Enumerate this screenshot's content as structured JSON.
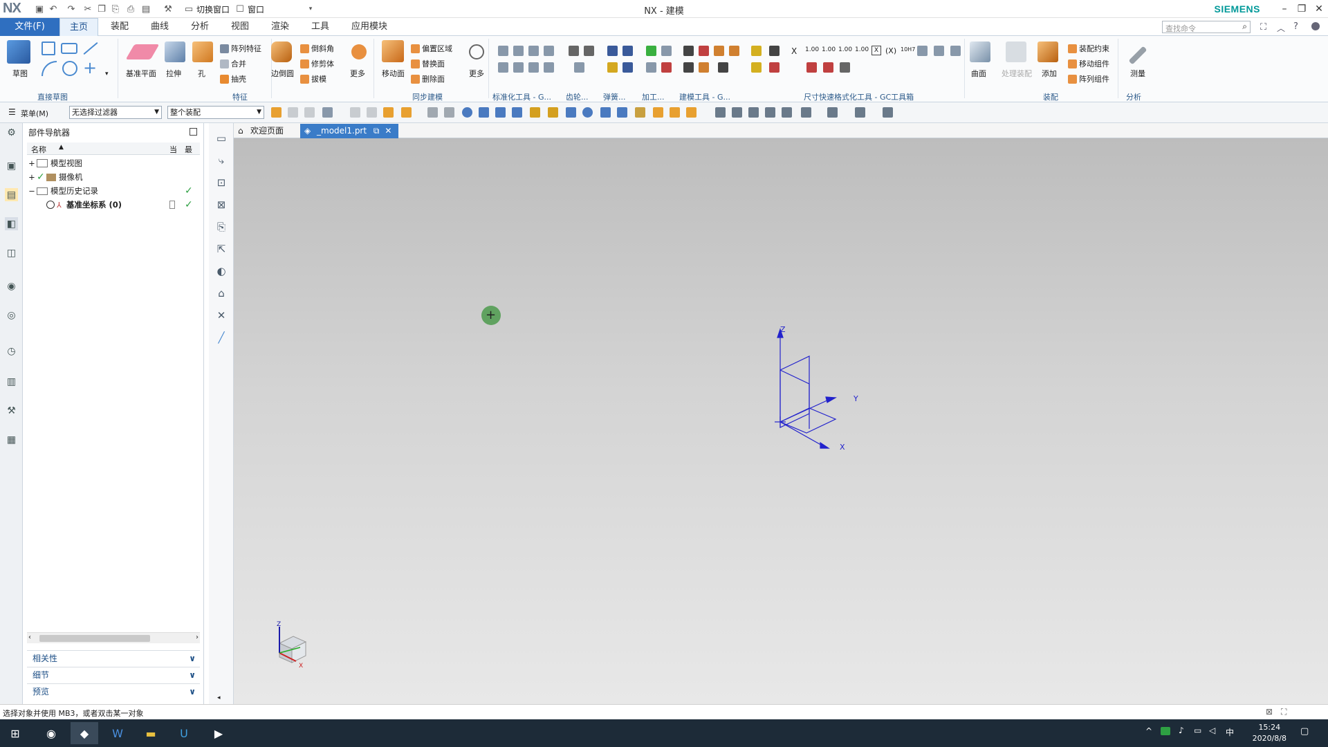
{
  "window": {
    "title": "NX - 建模",
    "brand": "NX",
    "vendor": "SIEMENS"
  },
  "quickaccess": {
    "switch_window": "切换窗口",
    "window": "窗口"
  },
  "menu_tabs": {
    "file": "文件(F)",
    "tabs": [
      "主页",
      "装配",
      "曲线",
      "分析",
      "视图",
      "渲染",
      "工具",
      "应用模块"
    ]
  },
  "ribbon": {
    "search_placeholder": "查找命令",
    "groups": [
      "直接草图",
      "特征",
      "同步建模",
      "标准化工具 - G...",
      "齿轮...",
      "弹簧...",
      "加工...",
      "建模工具 - G...",
      "尺寸快速格式化工具 - GC工具箱",
      "装配",
      "分析"
    ],
    "sketch": "草图",
    "datum_plane": "基准平面",
    "extrude": "拉伸",
    "hole": "孔",
    "pattern_feature": "阵列特征",
    "unite": "合并",
    "shell": "抽壳",
    "edge_blend": "边倒圆",
    "chamfer": "倒斜角",
    "trim_body": "修剪体",
    "draft": "拔模",
    "more": "更多",
    "move_face": "移动面",
    "offset_region": "偏置区域",
    "replace_face": "替换面",
    "delete_face": "删除面",
    "more2": "更多",
    "surface": "曲面",
    "process_assembly": "处理装配",
    "add": "添加",
    "assembly_constraints": "装配约束",
    "move_component": "移动组件",
    "pattern_component": "阵列组件",
    "measure": "测量",
    "dim_x": "X",
    "dim_vals": [
      "1.00",
      "1.00",
      "1.00",
      "1.00"
    ],
    "dim_paren": "(X)",
    "dim_h7": "10H7"
  },
  "toolbar2": {
    "menu": "菜单(M)",
    "filter": "无选择过滤器",
    "scope": "整个装配"
  },
  "navigator": {
    "title": "部件导航器",
    "col_name": "名称",
    "col_current": "当",
    "col_latest": "最",
    "nodes": [
      {
        "label": "模型视图"
      },
      {
        "label": "摄像机"
      },
      {
        "label": "模型历史记录"
      },
      {
        "label": "基准坐标系 (0)"
      }
    ],
    "sections": [
      "相关性",
      "细节",
      "预览"
    ]
  },
  "doc_tabs": {
    "welcome": "欢迎页面",
    "model": "_model1.prt"
  },
  "axes": {
    "x": "X",
    "y": "Y",
    "z": "Z"
  },
  "status": {
    "text": "选择对象并使用 MB3，或者双击某一对象"
  },
  "taskbar": {
    "time": "15:24",
    "date": "2020/8/8",
    "ime": "中"
  }
}
